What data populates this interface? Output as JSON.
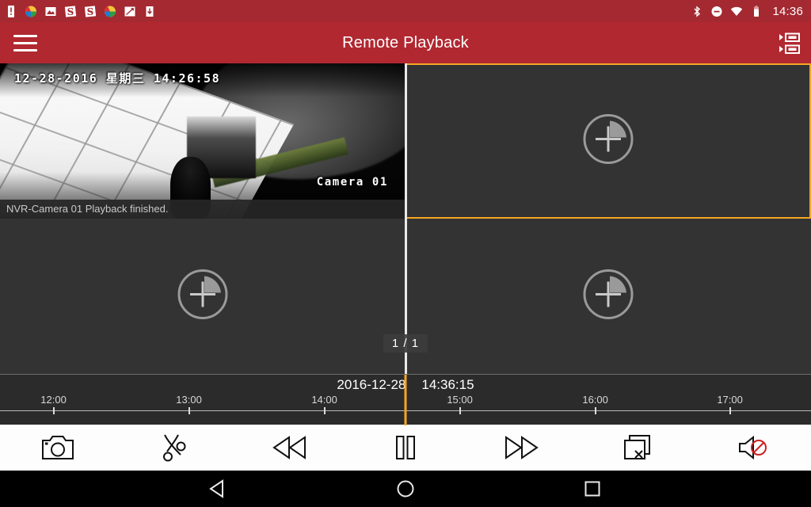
{
  "statusbar": {
    "time": "14:36",
    "left_icons": [
      {
        "name": "battery-alert-icon"
      },
      {
        "name": "color-wheel-icon"
      },
      {
        "name": "gallery-image-icon"
      },
      {
        "name": "s-app-icon"
      },
      {
        "name": "s-app-icon-2"
      },
      {
        "name": "color-wheel-icon-2"
      },
      {
        "name": "screenshot-icon"
      },
      {
        "name": "download-icon"
      }
    ],
    "right_icons": [
      {
        "name": "bluetooth-icon"
      },
      {
        "name": "do-not-disturb-icon"
      },
      {
        "name": "wifi-icon"
      },
      {
        "name": "battery-icon"
      }
    ],
    "colors": {
      "background": "#a42931"
    }
  },
  "appbar": {
    "title": "Remote Playback",
    "menu_icon": "hamburger-menu-icon",
    "action_icon": "multi-channel-playback-icon",
    "colors": {
      "background": "#b12830",
      "text": "#ffffff"
    }
  },
  "grid": {
    "page_indicator": "1 / 1",
    "selected_color": "#f5a623",
    "cells": [
      {
        "index": 1,
        "state": "playing",
        "osd_timestamp": "12-28-2016 星期三 14:26:58",
        "osd_camera": "Camera 01",
        "status_message": "NVR-Camera 01 Playback finished.",
        "add_icon": ""
      },
      {
        "index": 2,
        "state": "selected-empty",
        "add_icon": "add-channel-icon"
      },
      {
        "index": 3,
        "state": "empty",
        "add_icon": "add-channel-icon"
      },
      {
        "index": 4,
        "state": "empty",
        "add_icon": "add-channel-icon"
      }
    ]
  },
  "timeline": {
    "date": "2016-12-28",
    "time": "14:36:15",
    "playhead_color": "#f5a623",
    "playhead_x_pct": 50,
    "ticks": [
      {
        "label": "12:00",
        "x_pct": 6.6
      },
      {
        "label": "13:00",
        "x_pct": 23.3
      },
      {
        "label": "14:00",
        "x_pct": 40.0
      },
      {
        "label": "15:00",
        "x_pct": 56.7
      },
      {
        "label": "16:00",
        "x_pct": 73.4
      },
      {
        "label": "17:00",
        "x_pct": 90.0
      }
    ]
  },
  "controls": {
    "buttons": [
      {
        "name": "snapshot-button",
        "icon": "camera-icon",
        "label": "Snapshot"
      },
      {
        "name": "clip-button",
        "icon": "scissors-icon",
        "label": "Clip"
      },
      {
        "name": "rewind-button",
        "icon": "rewind-icon",
        "label": "Rewind"
      },
      {
        "name": "pause-button",
        "icon": "pause-icon",
        "label": "Pause"
      },
      {
        "name": "fast-forward-button",
        "icon": "fast-forward-icon",
        "label": "Fast Forward"
      },
      {
        "name": "close-all-button",
        "icon": "close-all-windows-icon",
        "label": "Close All"
      },
      {
        "name": "mute-button",
        "icon": "speaker-muted-icon",
        "label": "Mute"
      }
    ],
    "colors": {
      "background": "#fdfdfd",
      "icon": "#111111",
      "mute_accent": "#cc2222"
    }
  },
  "navbar": {
    "buttons": [
      {
        "name": "android-back-button",
        "icon": "back-triangle-icon"
      },
      {
        "name": "android-home-button",
        "icon": "home-circle-icon"
      },
      {
        "name": "android-recents-button",
        "icon": "recents-square-icon"
      }
    ]
  }
}
